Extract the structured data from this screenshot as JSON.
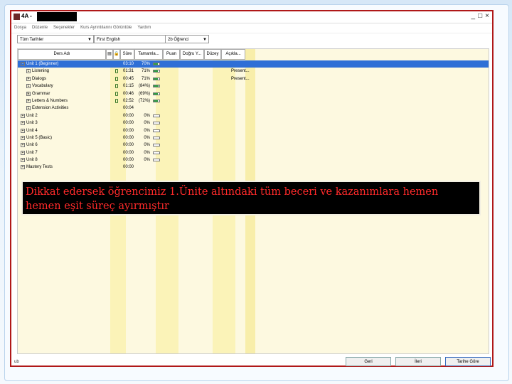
{
  "window": {
    "title": "4A -",
    "min": "_",
    "max": "□",
    "close": "×"
  },
  "menu": [
    "Dosya",
    "Düzenle",
    "Seçenekler",
    "Kurs Ayrıntılarını Görüntüle",
    "Yardım"
  ],
  "filters": {
    "date": "Tüm Tarihler",
    "course": "First English",
    "student": "2b Öğrenci"
  },
  "columns": [
    "Ders Adı",
    "Süre",
    "Tamamla...",
    "Puan",
    "Doğru Y...",
    "Düzey",
    "Açıkla..."
  ],
  "rows": [
    {
      "name": "Unit 1 (Beginner)",
      "level": 0,
      "expander": "-",
      "time": "03:10",
      "pct": "70%",
      "progress": 0.7,
      "lock": false,
      "note": "",
      "selected": true
    },
    {
      "name": "Listening",
      "level": 1,
      "expander": "L",
      "time": "01:31",
      "pct": "71%",
      "progress": 0.71,
      "lock": true,
      "note": "Present..."
    },
    {
      "name": "Dialogs",
      "level": 1,
      "expander": "F",
      "time": "00:45",
      "pct": "71%",
      "progress": 0.71,
      "lock": true,
      "note": "Present..."
    },
    {
      "name": "Vocabulary",
      "level": 1,
      "expander": "L",
      "time": "01:15",
      "pct": "(84%)",
      "progress": 0.84,
      "lock": true,
      "note": ""
    },
    {
      "name": "Grammar",
      "level": 1,
      "expander": "E",
      "time": "00:46",
      "pct": "(69%)",
      "progress": 0.69,
      "lock": true,
      "note": ""
    },
    {
      "name": "Letters & Numbers",
      "level": 1,
      "expander": "F",
      "time": "02:52",
      "pct": "(72%)",
      "progress": 0.72,
      "lock": true,
      "note": ""
    },
    {
      "name": "Extension Activities",
      "level": 1,
      "expander": "L",
      "time": "00:04",
      "pct": "",
      "progress": null,
      "lock": false,
      "note": ""
    },
    {
      "name": "Unit 2",
      "level": 0,
      "expander": "+",
      "time": "00:00",
      "pct": "0%",
      "progress": 0,
      "lock": false,
      "note": ""
    },
    {
      "name": "Unit 3",
      "level": 0,
      "expander": "+",
      "time": "00:00",
      "pct": "0%",
      "progress": 0,
      "lock": false,
      "note": ""
    },
    {
      "name": "Unit 4",
      "level": 0,
      "expander": "+",
      "time": "00:00",
      "pct": "0%",
      "progress": 0,
      "lock": false,
      "note": ""
    },
    {
      "name": "Unit 5 (Basic)",
      "level": 0,
      "expander": "+",
      "time": "00:00",
      "pct": "0%",
      "progress": 0,
      "lock": false,
      "note": ""
    },
    {
      "name": "Unit 6",
      "level": 0,
      "expander": "+",
      "time": "00:00",
      "pct": "0%",
      "progress": 0,
      "lock": false,
      "note": ""
    },
    {
      "name": "Unit 7",
      "level": 0,
      "expander": "+",
      "time": "00:00",
      "pct": "0%",
      "progress": 0,
      "lock": false,
      "note": ""
    },
    {
      "name": "Unit 8",
      "level": 0,
      "expander": "+",
      "time": "00:00",
      "pct": "0%",
      "progress": 0,
      "lock": false,
      "note": ""
    },
    {
      "name": "Mastery Tests",
      "level": 0,
      "expander": "+",
      "time": "00:00",
      "pct": "",
      "progress": null,
      "lock": false,
      "note": ""
    }
  ],
  "annotation": "Dikkat edersek öğrencimiz 1.Ünite altındaki tüm beceri ve kazanımlara hemen hemen eşit süreç ayırmıştır",
  "buttons": {
    "back": "Geri",
    "forward": "İleri",
    "date_range": "Tarihe Göre"
  },
  "status": "ub"
}
